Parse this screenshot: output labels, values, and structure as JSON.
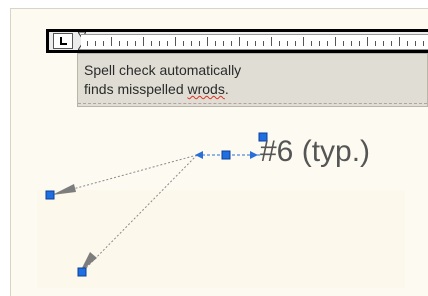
{
  "text_box": {
    "line1": "Spell check automatically",
    "line2_before": "finds misspelled ",
    "line2_misspelled": "wrods",
    "line2_after": "."
  },
  "callout": {
    "label": "#6 (typ.)"
  },
  "colors": {
    "canvas_background": "#fdfaf1",
    "text_box_background": "#e0ded4",
    "grip_blue": "#1f6fe0",
    "spell_underline": "#e03020"
  },
  "icons": {
    "tab_stop": "left-tab-stop-icon",
    "indent": "hanging-indent-marker-icon",
    "grip": "square-grip-icon"
  }
}
